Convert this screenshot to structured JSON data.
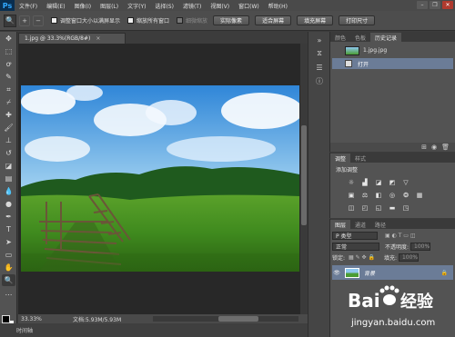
{
  "app": {
    "logo": "Ps"
  },
  "menu": [
    "文件(F)",
    "编辑(E)",
    "图像(I)",
    "图层(L)",
    "文字(Y)",
    "选择(S)",
    "滤镜(T)",
    "视图(V)",
    "窗口(W)",
    "帮助(H)"
  ],
  "options_bar": {
    "checkbox_resize": "调整窗口大小以满屏显示",
    "checkbox_zoom_all": "缩放所有窗口",
    "checkbox_scrubby": "细微缩放",
    "btn_actual": "实际像素",
    "btn_fit": "适合屏幕",
    "btn_fill": "填充屏幕",
    "btn_print": "打印尺寸"
  },
  "document": {
    "tab_title": "1.jpg @ 33.3%(RGB/8#)",
    "tab_close": "×",
    "zoom": "33.33%",
    "doc_info": "文档:5.93M/5.93M",
    "bottom_label": "时间轴"
  },
  "history_panel": {
    "tabs": [
      "颜色",
      "色板",
      "历史记录"
    ],
    "snapshot": "1.jpg.jpg",
    "step": "打开"
  },
  "adjust_panel": {
    "tabs": [
      "调整",
      "样式"
    ],
    "title": "添加调整",
    "icons": [
      "brightness-icon",
      "levels-icon",
      "curves-icon",
      "exposure-icon",
      "vibrance-icon",
      "hue-icon",
      "colorbalance-icon",
      "bw-icon",
      "photofilter-icon",
      "channelmixer-icon",
      "colorlookup-icon",
      "invert-icon",
      "posterize-icon",
      "threshold-icon",
      "gradientmap-icon",
      "selectivecolor-icon"
    ]
  },
  "layers_panel": {
    "tabs": [
      "图层",
      "通道",
      "路径"
    ],
    "kind": "P 类型",
    "blend_mode": "正常",
    "opacity_label": "不透明度:",
    "opacity_value": "100%",
    "lock_label": "锁定:",
    "fill_label": "填充:",
    "fill_value": "100%",
    "layer_name": "背景"
  },
  "watermark": {
    "brand": "Bai",
    "brand2": "经验",
    "url": "jingyan.baidu.com"
  },
  "colors": {
    "accent_selection": "#6b7c97",
    "panel_bg": "#535353",
    "canvas_bg": "#282828"
  }
}
